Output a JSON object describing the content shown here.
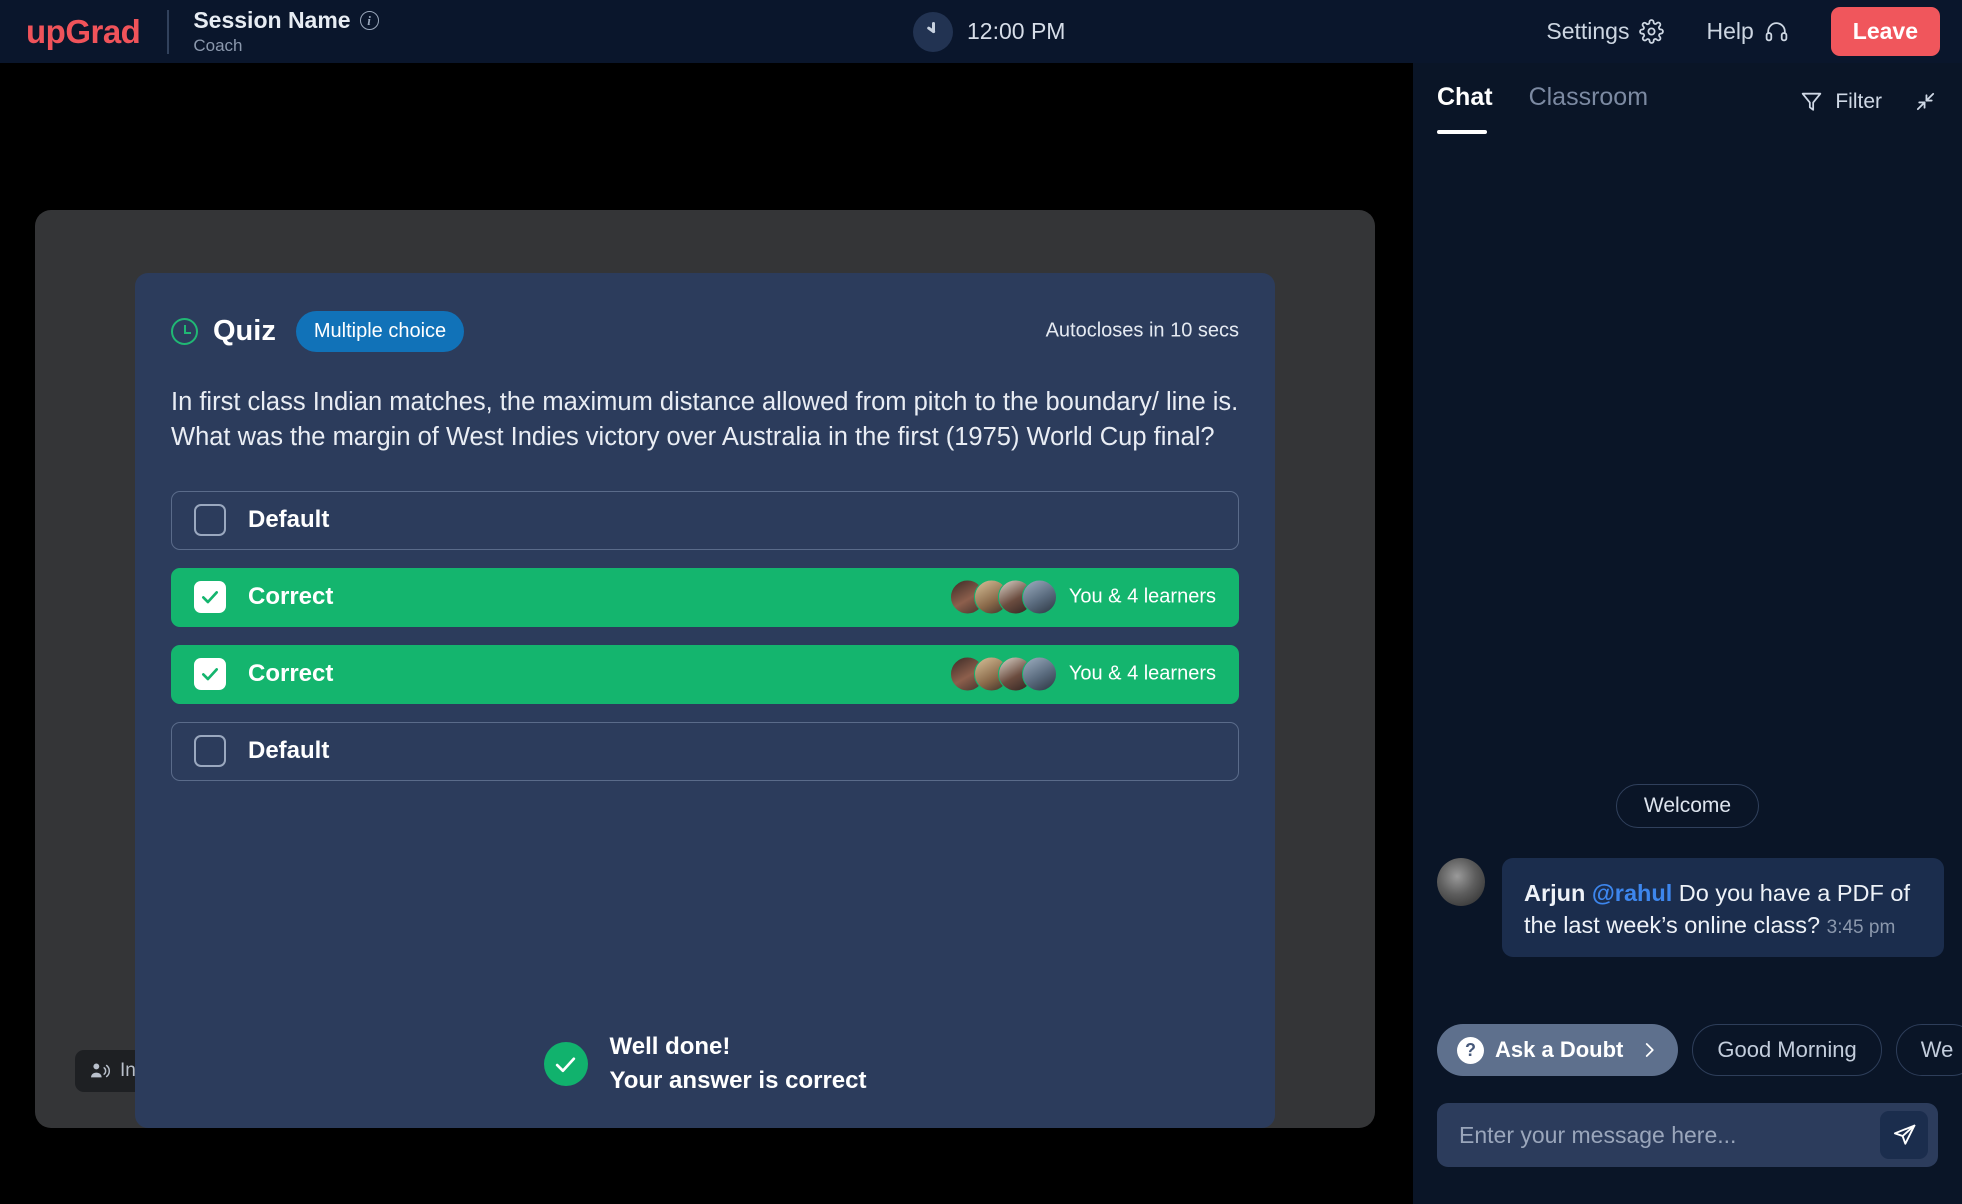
{
  "topbar": {
    "brand": "upGrad",
    "session_name": "Session Name",
    "session_role": "Coach",
    "info_glyph": "i",
    "clock_time": "12:00 PM",
    "settings_label": "Settings",
    "help_label": "Help",
    "leave_label": "Leave"
  },
  "stage": {
    "speaker_badge_label": "Instructor"
  },
  "quiz": {
    "title": "Quiz",
    "type_pill": "Multiple choice",
    "autoclose": "Autocloses in 10 secs",
    "question": "In first class Indian matches, the maximum distance allowed from pitch to the boundary/ line is. What was the margin of West Indies victory over Australia in the first (1975) World Cup final?",
    "options": [
      {
        "label": "Default",
        "state": "default",
        "learners": ""
      },
      {
        "label": "Correct",
        "state": "correct",
        "learners": "You & 4 learners"
      },
      {
        "label": "Correct",
        "state": "correct",
        "learners": "You & 4 learners"
      },
      {
        "label": "Default",
        "state": "default",
        "learners": ""
      }
    ],
    "feedback_title": "Well done!",
    "feedback_sub": "Your answer is correct",
    "accent_green": "#14b56e",
    "accent_blue": "#1172b8"
  },
  "chat": {
    "tab_chat": "Chat",
    "tab_classroom": "Classroom",
    "filter_label": "Filter",
    "welcome_label": "Welcome",
    "message": {
      "sender": "Arjun",
      "mention": "@rahul",
      "body": "Do you have a PDF of the last week’s online class?",
      "time": "3:45 pm"
    },
    "chips": [
      {
        "label": "Ask a Doubt",
        "style": "primary"
      },
      {
        "label": "Good Morning",
        "style": "outline"
      },
      {
        "label": "We",
        "style": "outline"
      }
    ],
    "composer_placeholder": "Enter your message here...",
    "composer_value": ""
  }
}
